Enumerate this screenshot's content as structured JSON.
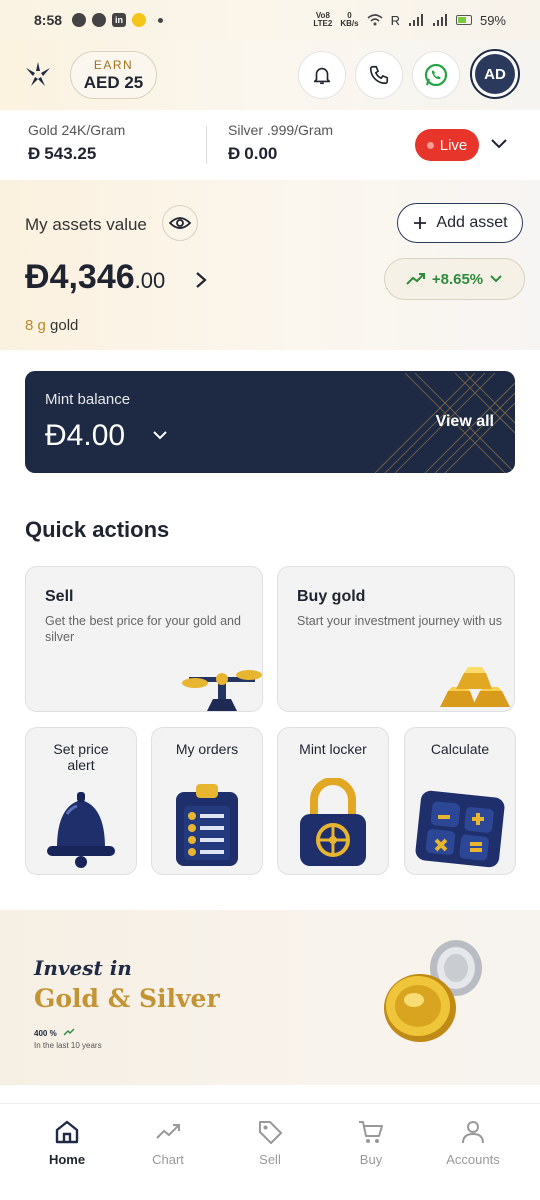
{
  "status_bar": {
    "time": "8:58",
    "network_top": "Vo8",
    "network_bottom": "LTE2",
    "speed_top": "0",
    "speed_bottom": "KB/s",
    "roaming": "R",
    "battery": "59%"
  },
  "header": {
    "earn_label": "EARN",
    "earn_value": "AED 25",
    "avatar_initials": "AD"
  },
  "prices": {
    "gold_label": "Gold 24K/Gram",
    "gold_value": "543.25",
    "silver_label": "Silver .999/Gram",
    "silver_value": "0.00",
    "live_label": "Live",
    "currency_symbol": "Ð"
  },
  "assets": {
    "label": "My assets value",
    "add_asset_label": "Add asset",
    "currency_symbol": "Ð",
    "value_main": "4,346",
    "value_cents": ".00",
    "growth": "+8.65%",
    "gold_amount": "8 g",
    "gold_suffix": " gold"
  },
  "mint": {
    "label": "Mint balance",
    "currency_symbol": "Ð",
    "value": "4.00",
    "view_all": "View all"
  },
  "quick_actions": {
    "title": "Quick actions",
    "sell_title": "Sell",
    "sell_sub": "Get the best price for your gold and silver",
    "buy_title": "Buy gold",
    "buy_sub": "Start your investment journey with us",
    "price_alert": "Set price alert",
    "orders": "My orders",
    "locker": "Mint locker",
    "calculate": "Calculate"
  },
  "invest": {
    "line1": "Invest in",
    "line2": "Gold & Silver",
    "stat": "400 %",
    "stat_sub": "In the last 10 years"
  },
  "nav": {
    "home": "Home",
    "chart": "Chart",
    "sell": "Sell",
    "buy": "Buy",
    "accounts": "Accounts"
  },
  "colors": {
    "navy": "#1e2a44",
    "gold": "#c29434",
    "live_red": "#e8352b",
    "growth_green": "#2e8b3e"
  }
}
